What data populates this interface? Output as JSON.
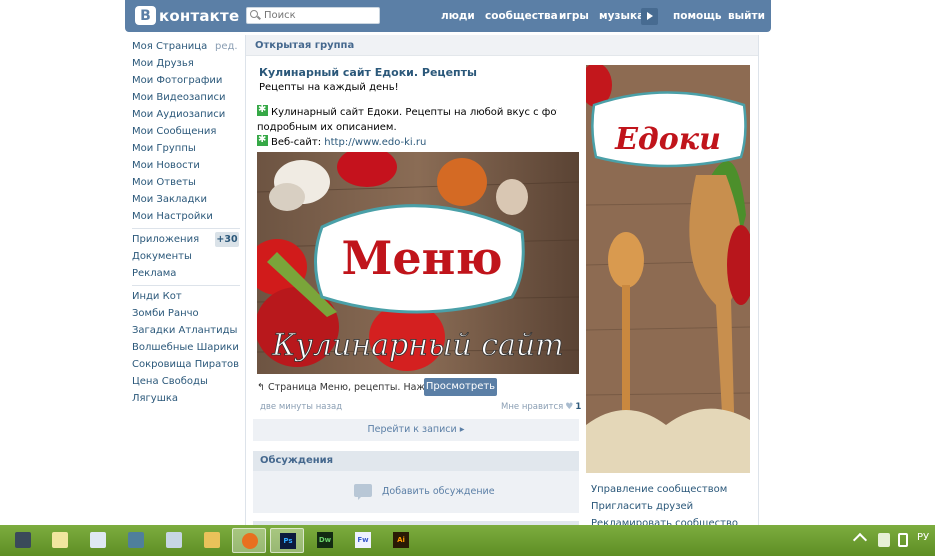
{
  "header": {
    "logo_text": "контакте",
    "logo_letter": "В",
    "search_placeholder": "Поиск",
    "nav": [
      "люди",
      "сообщества",
      "игры",
      "музыка",
      "помощь",
      "выйти"
    ],
    "brand_color": "#5b7fa6"
  },
  "sidebar": {
    "edit_label": "ред.",
    "group1": [
      "Моя Страница",
      "Мои Друзья",
      "Мои Фотографии",
      "Мои Видеозаписи",
      "Мои Аудиозаписи",
      "Мои Сообщения",
      "Мои Группы",
      "Мои Новости",
      "Мои Ответы",
      "Мои Закладки",
      "Мои Настройки"
    ],
    "group2": [
      "Приложения",
      "Документы",
      "Реклама"
    ],
    "apps_badge": "+30",
    "group3": [
      "Инди Кот",
      "Зомби Ранчо",
      "Загадки Атлантиды",
      "Волшебные Шарики",
      "Сокровища Пиратов",
      "Цена Свободы",
      "Лягушка"
    ]
  },
  "group": {
    "type_label": "Открытая группа",
    "name": "Кулинарный сайт Едоки. Рецепты",
    "status": "Рецепты на каждый день!",
    "desc_line1": "Кулинарный сайт Едоки. Рецепты на любой вкус с фотографиями с",
    "desc_line2": "подробным их описанием.",
    "website_label": "Веб-сайт:",
    "website_url": "http://www.edo-ki.ru"
  },
  "post": {
    "image_title": "Меню",
    "image_subtitle": "Кулинарный сайт",
    "link_text": "Страница Меню, рецепты. Нажми...",
    "view_button": "Просмотреть",
    "time": "две минуты назад",
    "likes_label": "Мне нравится",
    "likes_count": "1",
    "goto_label": "Перейти к записи ▸"
  },
  "discussions": {
    "title": "Обсуждения",
    "add_label": "Добавить обсуждение"
  },
  "avatar": {
    "logo_text": "Едоки"
  },
  "management": [
    "Управление сообществом",
    "Пригласить друзей",
    "Рекламировать сообщество"
  ],
  "taskbar": {
    "apps": [
      "window-icon",
      "notepad-icon",
      "document-icon",
      "tool-icon",
      "archive-icon",
      "folder-icon",
      "firefox-icon",
      "photoshop-icon",
      "dreamweaver-icon",
      "fireworks-icon",
      "illustrator-icon"
    ],
    "app_labels": [
      "Ps",
      "Dw",
      "Fw",
      "Ai"
    ],
    "lang": "РУ"
  }
}
